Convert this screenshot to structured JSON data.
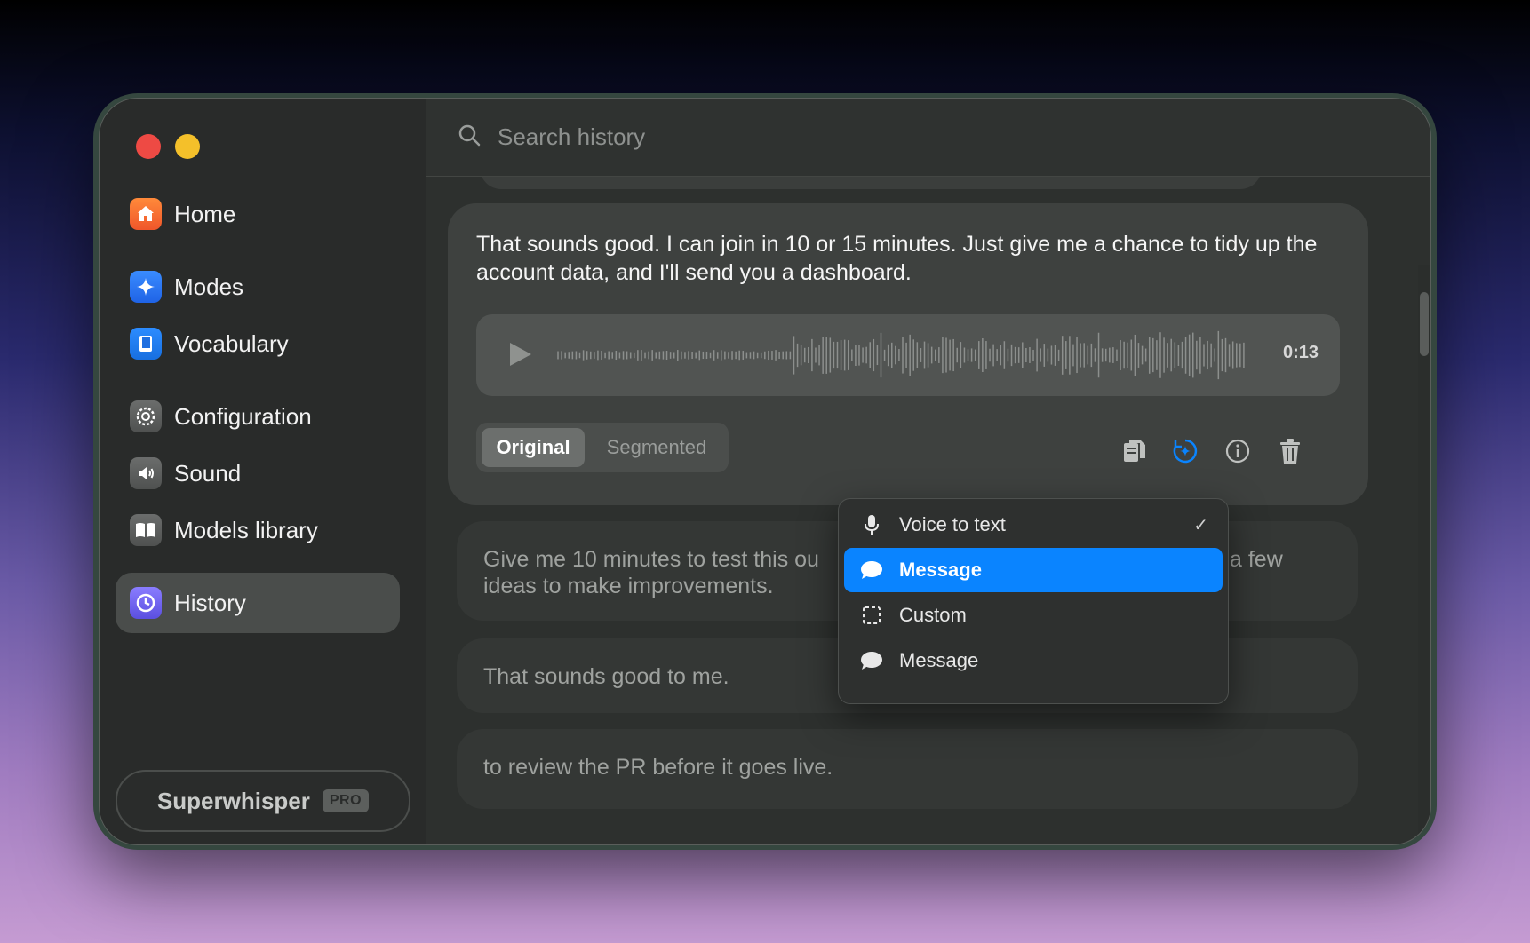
{
  "sidebar": {
    "items": [
      {
        "label": "Home",
        "icon": "home-icon"
      },
      {
        "label": "Modes",
        "icon": "sparkle-icon"
      },
      {
        "label": "Vocabulary",
        "icon": "book-icon"
      },
      {
        "label": "Configuration",
        "icon": "gear-icon"
      },
      {
        "label": "Sound",
        "icon": "speaker-icon"
      },
      {
        "label": "Models library",
        "icon": "open-book-icon"
      },
      {
        "label": "History",
        "icon": "history-icon",
        "active": true
      }
    ],
    "app_name": "Superwhisper",
    "badge": "PRO"
  },
  "search": {
    "placeholder": "Search history"
  },
  "main_card": {
    "text": "That sounds good. I can join in 10 or 15 minutes. Just give me a chance to tidy up the account data, and I'll send you a dashboard.",
    "duration": "0:13",
    "tabs": [
      "Original",
      "Segmented"
    ],
    "active_tab": "Original",
    "actions": [
      "copy-icon",
      "sparkle-reprocess-icon",
      "info-icon",
      "trash-icon"
    ]
  },
  "history": [
    {
      "text_left": "Give me 10 minutes to test this ou",
      "text_right": "a few",
      "line2": "ideas to make improvements."
    },
    {
      "text": "That sounds good to me."
    },
    {
      "text": "to review the PR before it goes live."
    }
  ],
  "dropdown": {
    "items": [
      {
        "label": "Voice to text",
        "icon": "microphone-icon",
        "checked": true
      },
      {
        "label": "Message",
        "icon": "speech-bubble-icon",
        "selected": true
      },
      {
        "label": "Custom",
        "icon": "dashed-square-icon"
      },
      {
        "label": "Message",
        "icon": "speech-bubble-icon"
      }
    ],
    "check": "✓"
  },
  "colors": {
    "accent": "#0a84ff",
    "window_frame": "#35473f",
    "close": "#ee4a44",
    "minimize": "#f4c02a"
  }
}
